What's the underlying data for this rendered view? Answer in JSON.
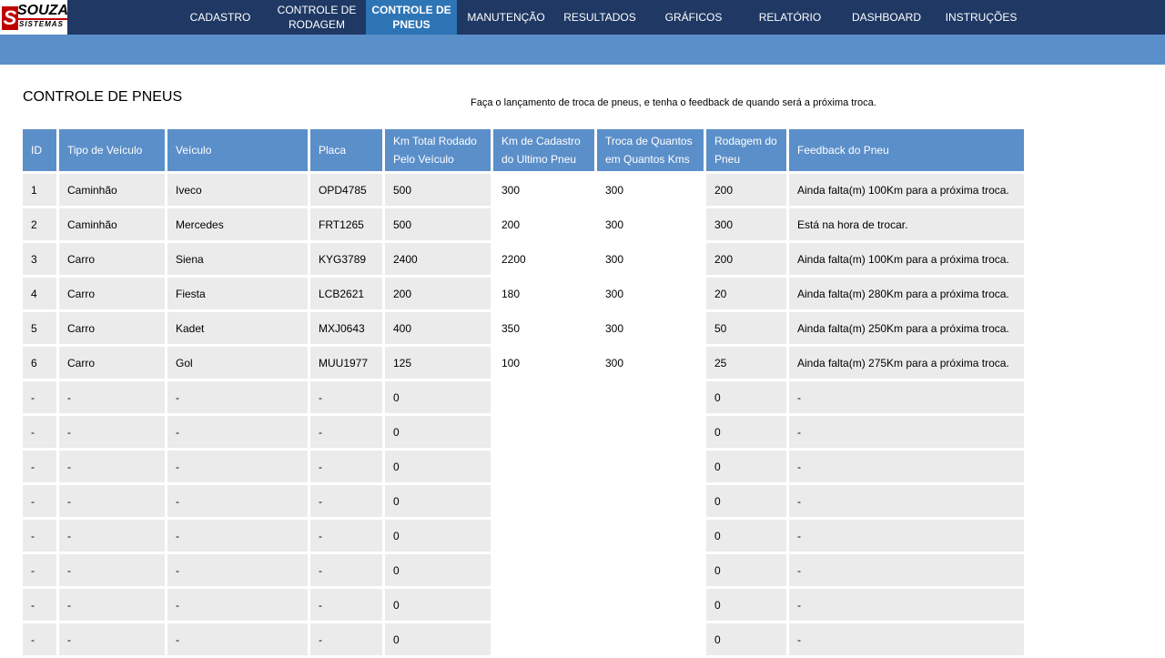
{
  "logo": {
    "word1": "SOUZA",
    "word2": "SISTEMAS",
    "mark": "S"
  },
  "nav": {
    "items": [
      {
        "label": "CADASTRO"
      },
      {
        "label": "CONTROLE DE RODAGEM"
      },
      {
        "label": "CONTROLE DE PNEUS",
        "active": true
      },
      {
        "label": "MANUTENÇÃO"
      },
      {
        "label": "RESULTADOS"
      },
      {
        "label": "GRÁFICOS"
      },
      {
        "label": "RELATÓRIO"
      },
      {
        "label": "DASHBOARD"
      },
      {
        "label": "INSTRUÇÕES"
      }
    ]
  },
  "page": {
    "title": "CONTROLE DE PNEUS",
    "subtitle": "Faça o lançamento de troca de pneus, e tenha o feedback de quando será a próxima troca."
  },
  "table": {
    "headers": [
      "ID",
      "Tipo de Veículo",
      "Veículo",
      "Placa",
      "Km Total Rodado Pelo Veículo",
      "Km de Cadastro do Ultimo Pneu",
      "Troca de Quantos em Quantos Kms",
      "Rodagem do Pneu",
      "Feedback do Pneu"
    ],
    "rows": [
      [
        "1",
        "Caminhão",
        "Iveco",
        "OPD4785",
        "500",
        "300",
        "300",
        "200",
        "Ainda falta(m) 100Km para a próxima troca."
      ],
      [
        "2",
        "Caminhão",
        "Mercedes",
        "FRT1265",
        "500",
        "200",
        "300",
        "300",
        "Está na hora de trocar."
      ],
      [
        "3",
        "Carro",
        "Siena",
        "KYG3789",
        "2400",
        "2200",
        "300",
        "200",
        "Ainda falta(m) 100Km para a próxima troca."
      ],
      [
        "4",
        "Carro",
        "Fiesta",
        "LCB2621",
        "200",
        "180",
        "300",
        "20",
        "Ainda falta(m) 280Km para a próxima troca."
      ],
      [
        "5",
        "Carro",
        "Kadet",
        "MXJ0643",
        "400",
        "350",
        "300",
        "50",
        "Ainda falta(m) 250Km para a próxima troca."
      ],
      [
        "6",
        "Carro",
        "Gol",
        "MUU1977",
        "125",
        "100",
        "300",
        "25",
        "Ainda falta(m) 275Km para a próxima troca."
      ],
      [
        "-",
        "-",
        "-",
        "-",
        "0",
        "",
        "",
        "0",
        "-"
      ],
      [
        "-",
        "-",
        "-",
        "-",
        "0",
        "",
        "",
        "0",
        "-"
      ],
      [
        "-",
        "-",
        "-",
        "-",
        "0",
        "",
        "",
        "0",
        "-"
      ],
      [
        "-",
        "-",
        "-",
        "-",
        "0",
        "",
        "",
        "0",
        "-"
      ],
      [
        "-",
        "-",
        "-",
        "-",
        "0",
        "",
        "",
        "0",
        "-"
      ],
      [
        "-",
        "-",
        "-",
        "-",
        "0",
        "",
        "",
        "0",
        "-"
      ],
      [
        "-",
        "-",
        "-",
        "-",
        "0",
        "",
        "",
        "0",
        "-"
      ],
      [
        "-",
        "-",
        "-",
        "-",
        "0",
        "",
        "",
        "0",
        "-"
      ]
    ]
  }
}
